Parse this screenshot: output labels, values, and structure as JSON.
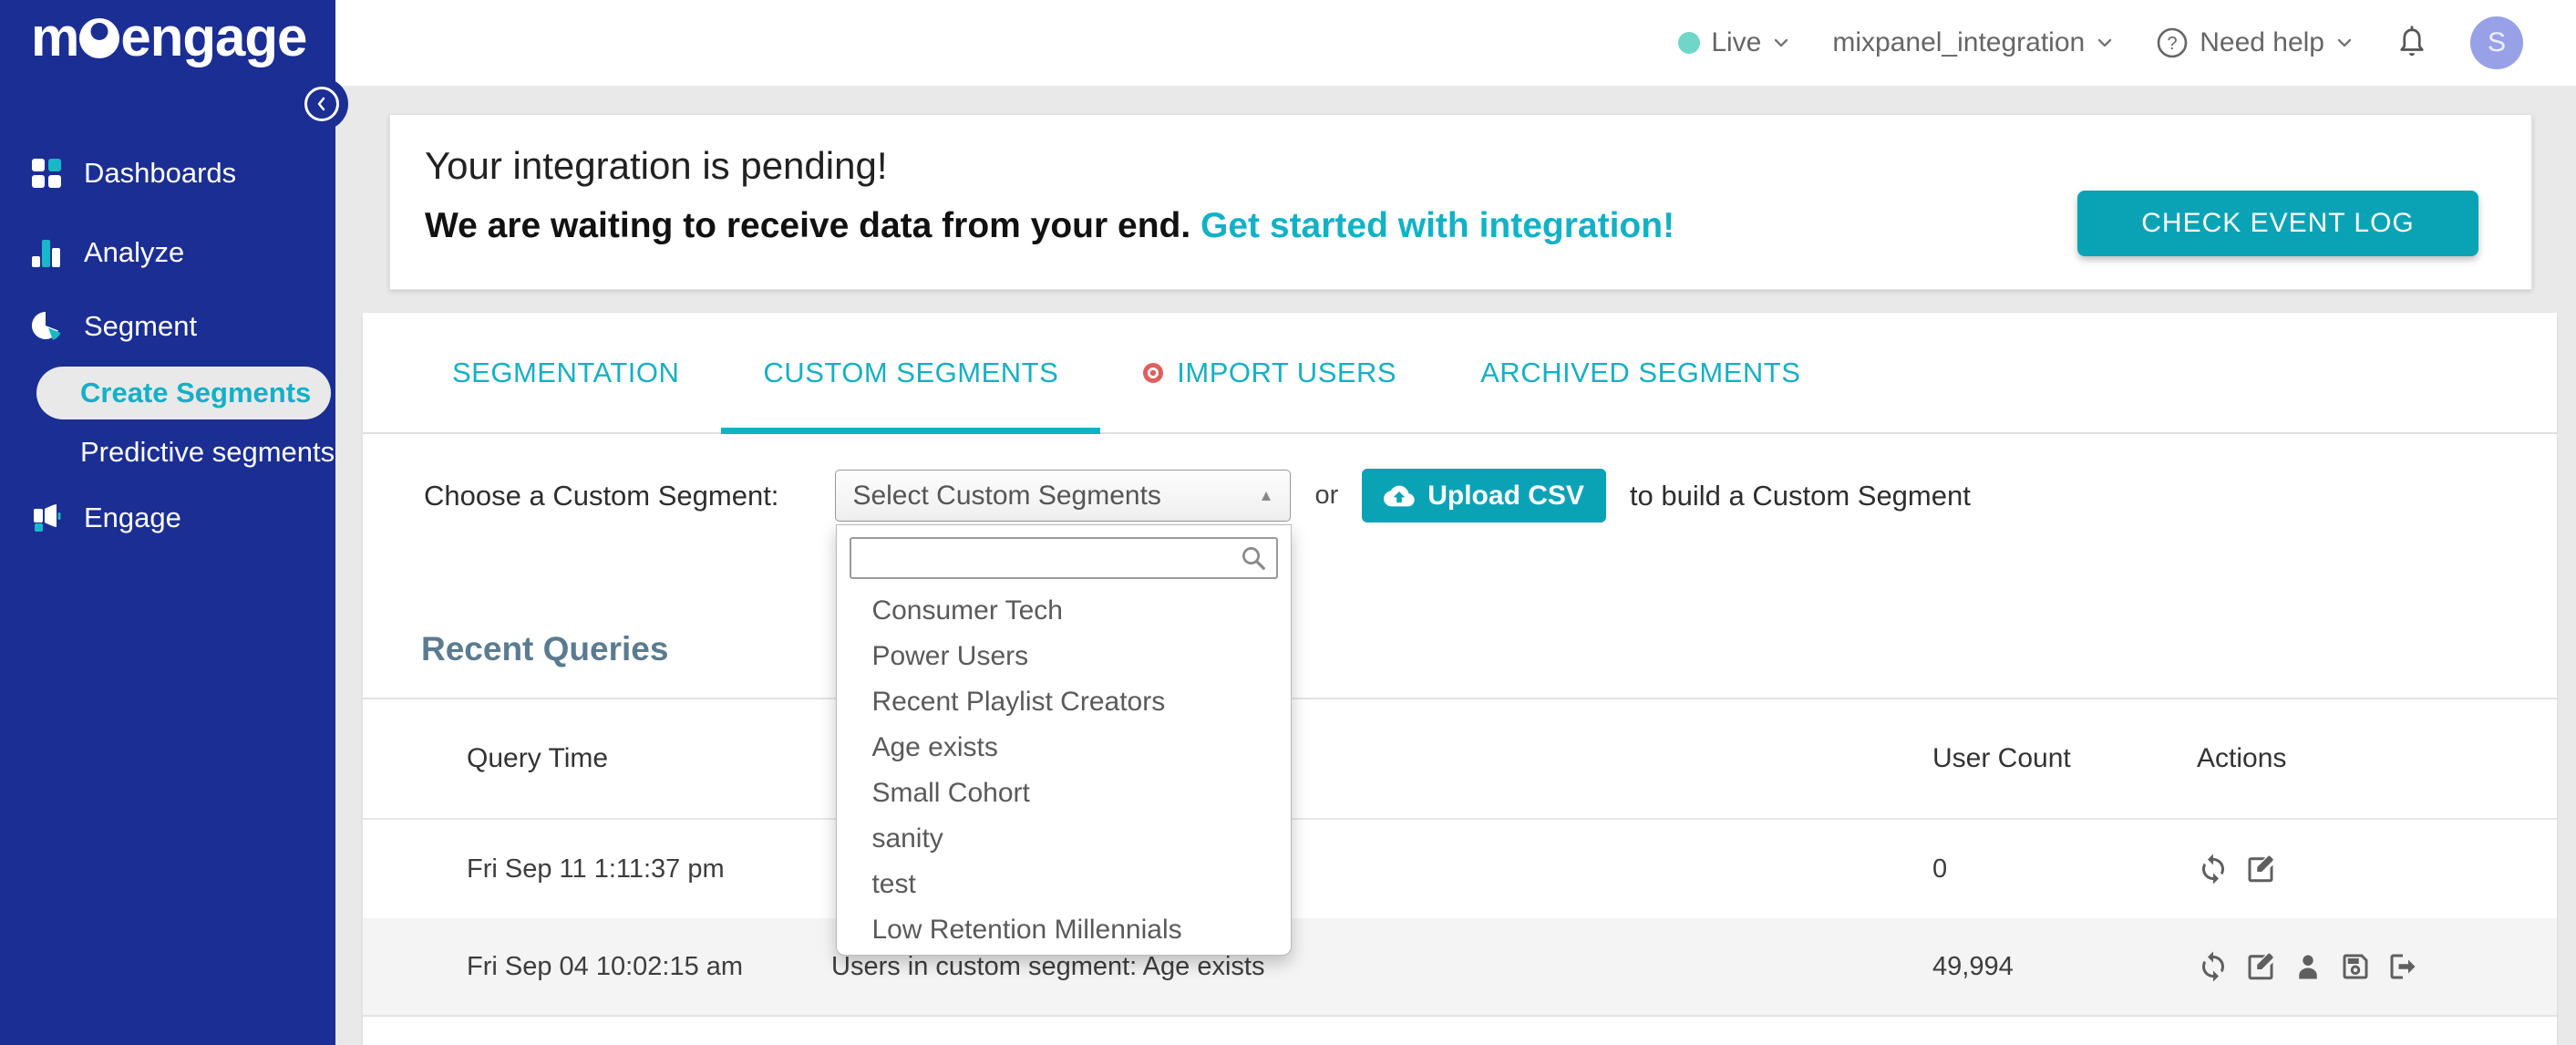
{
  "sidebar": {
    "logo_pre": "m",
    "logo_post": "engage",
    "items": [
      {
        "label": "Dashboards",
        "icon": "grid-icon"
      },
      {
        "label": "Analyze",
        "icon": "bar-chart-icon"
      },
      {
        "label": "Segment",
        "icon": "pie-chart-icon"
      },
      {
        "label": "Create Segments",
        "active": true
      },
      {
        "label": "Predictive segments"
      },
      {
        "label": "Engage",
        "icon": "megaphone-icon"
      }
    ]
  },
  "topbar": {
    "env_label": "Live",
    "project_label": "mixpanel_integration",
    "help_label": "Need help",
    "avatar_initial": "S"
  },
  "banner": {
    "title": "Your integration is pending!",
    "message": "We are waiting to receive data from your end.",
    "link_label": "Get started with integration!",
    "button_label": "CHECK EVENT LOG"
  },
  "tabs": {
    "items": [
      {
        "label": "SEGMENTATION"
      },
      {
        "label": "CUSTOM SEGMENTS",
        "active": true
      },
      {
        "label": "IMPORT USERS",
        "badge": "red-dot"
      },
      {
        "label": "ARCHIVED SEGMENTS"
      }
    ]
  },
  "picker": {
    "label": "Choose a Custom Segment:",
    "select_value": "Select Custom Segments",
    "or_label": "or",
    "upload_label": "Upload CSV",
    "suffix_label": "to build a Custom Segment",
    "search_value": "",
    "options": [
      {
        "label": "Consumer Tech"
      },
      {
        "label": "Power Users"
      },
      {
        "label": "Recent Playlist Creators"
      },
      {
        "label": "Age exists"
      },
      {
        "label": "Small Cohort"
      },
      {
        "label": "sanity"
      },
      {
        "label": "test"
      },
      {
        "label": "Low Retention Millennials"
      }
    ]
  },
  "recent_queries": {
    "heading": "Recent Queries",
    "columns": {
      "time": "Query Time",
      "count": "User Count",
      "actions": "Actions"
    },
    "rows": [
      {
        "time": "Fri Sep 11 1:11:37 pm",
        "query": "",
        "count": "0",
        "actions": [
          "refresh-icon",
          "edit-icon"
        ]
      },
      {
        "time": "Fri Sep 04 10:02:15 am",
        "query": "Users in custom segment: Age exists",
        "count": "49,994",
        "actions": [
          "refresh-icon",
          "edit-icon",
          "user-icon",
          "save-icon",
          "export-icon"
        ]
      }
    ]
  },
  "colors": {
    "sidebar_blue": "#1b2e93",
    "accent_teal": "#12b1c6",
    "button_teal": "#0aa3b6",
    "live_dot_teal": "#6fd6c8",
    "avatar_purple": "#98a1e8",
    "heading_slate": "#5b7b90",
    "import_dot_red": "#e05e5e"
  }
}
